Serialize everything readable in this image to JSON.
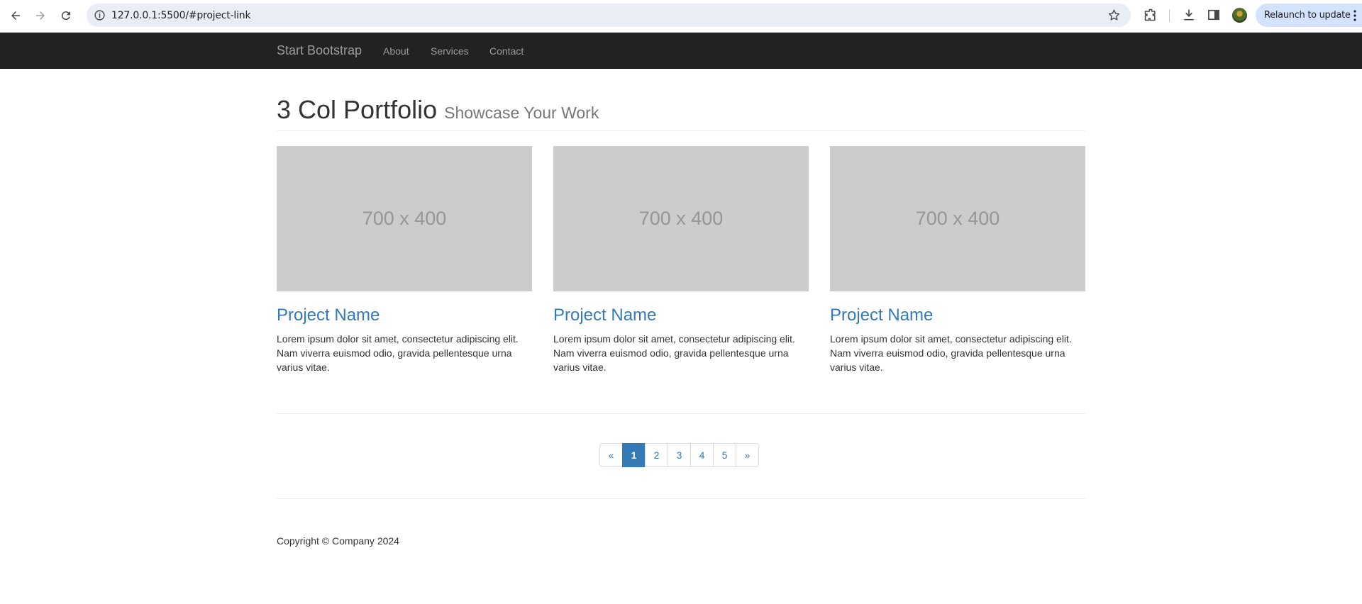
{
  "browser": {
    "url": "127.0.0.1:5500/#project-link",
    "relaunch_label": "Relaunch to update"
  },
  "navbar": {
    "brand": "Start Bootstrap",
    "links": [
      "About",
      "Services",
      "Contact"
    ]
  },
  "header": {
    "title": "3 Col Portfolio",
    "subtitle": "Showcase Your Work"
  },
  "projects": [
    {
      "image_label": "700 x 400",
      "title": "Project Name",
      "text": "Lorem ipsum dolor sit amet, consectetur adipiscing elit. Nam viverra euismod odio, gravida pellentesque urna varius vitae."
    },
    {
      "image_label": "700 x 400",
      "title": "Project Name",
      "text": "Lorem ipsum dolor sit amet, consectetur adipiscing elit. Nam viverra euismod odio, gravida pellentesque urna varius vitae."
    },
    {
      "image_label": "700 x 400",
      "title": "Project Name",
      "text": "Lorem ipsum dolor sit amet, consectetur adipiscing elit. Nam viverra euismod odio, gravida pellentesque urna varius vitae."
    }
  ],
  "pagination": {
    "prev": "«",
    "pages": [
      "1",
      "2",
      "3",
      "4",
      "5"
    ],
    "next": "»",
    "active": "1"
  },
  "footer": {
    "copyright": "Copyright © Company 2024"
  },
  "colors": {
    "navbar_bg": "#222222",
    "link": "#337ab7",
    "placeholder_bg": "#cccccc"
  }
}
